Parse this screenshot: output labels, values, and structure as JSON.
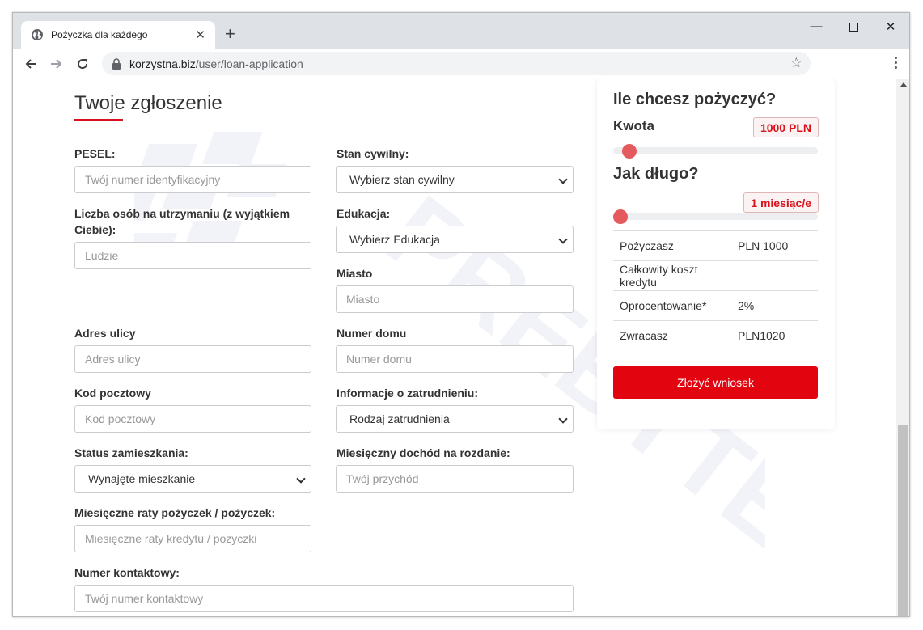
{
  "browser": {
    "tab_title": "Pożyczka dla każdego",
    "url_domain": "korzystna.biz",
    "url_path": "/user/loan-application"
  },
  "form": {
    "heading": "Twoje zgłoszenie",
    "pesel_label": "PESEL:",
    "pesel_placeholder": "Twój numer identyfikacyjny",
    "stan_label": "Stan cywilny:",
    "stan_value": "Wybierz stan cywilny",
    "dependents_label": "Liczba osób na utrzymaniu (z wyjątkiem Ciebie):",
    "dependents_placeholder": "Ludzie",
    "edukacja_label": "Edukacja:",
    "edukacja_value": "Wybierz Edukacja",
    "miasto_label": "Miasto",
    "miasto_placeholder": "Miasto",
    "adres_label": "Adres ulicy",
    "adres_placeholder": "Adres ulicy",
    "numer_domu_label": "Numer domu",
    "numer_domu_placeholder": "Numer domu",
    "kod_label": "Kod pocztowy",
    "kod_placeholder": "Kod pocztowy",
    "zatrudnienie_label": "Informacje o zatrudnieniu:",
    "zatrudnienie_value": "Rodzaj zatrudnienia",
    "status_label": "Status zamieszkania:",
    "status_value": "Wynajęte mieszkanie",
    "dochod_label": "Miesięczny dochód na rozdanie:",
    "dochod_placeholder": "Twój przychód",
    "raty_label": "Miesięczne raty pożyczek / pożyczek:",
    "raty_placeholder": "Miesięczne raty kredytu / pożyczki",
    "kontakt_label": "Numer kontaktowy:",
    "kontakt_placeholder": "Twój numer kontaktowy"
  },
  "calculator": {
    "title": "Ile chcesz pożyczyć?",
    "amount_label": "Kwota",
    "amount_value": "1000 PLN",
    "duration_label": "Jak długo?",
    "duration_value": "1 miesiąc/e",
    "summary": [
      {
        "label": "Pożyczasz",
        "value": "PLN 1000"
      },
      {
        "label": "Całkowity koszt kredytu",
        "value": ""
      },
      {
        "label": "Oprocentowanie*",
        "value": "2%"
      },
      {
        "label": "Zwracasz",
        "value": "PLN1020"
      }
    ],
    "submit_label": "Złożyć wniosek"
  },
  "watermark_text": "PREBYTES"
}
